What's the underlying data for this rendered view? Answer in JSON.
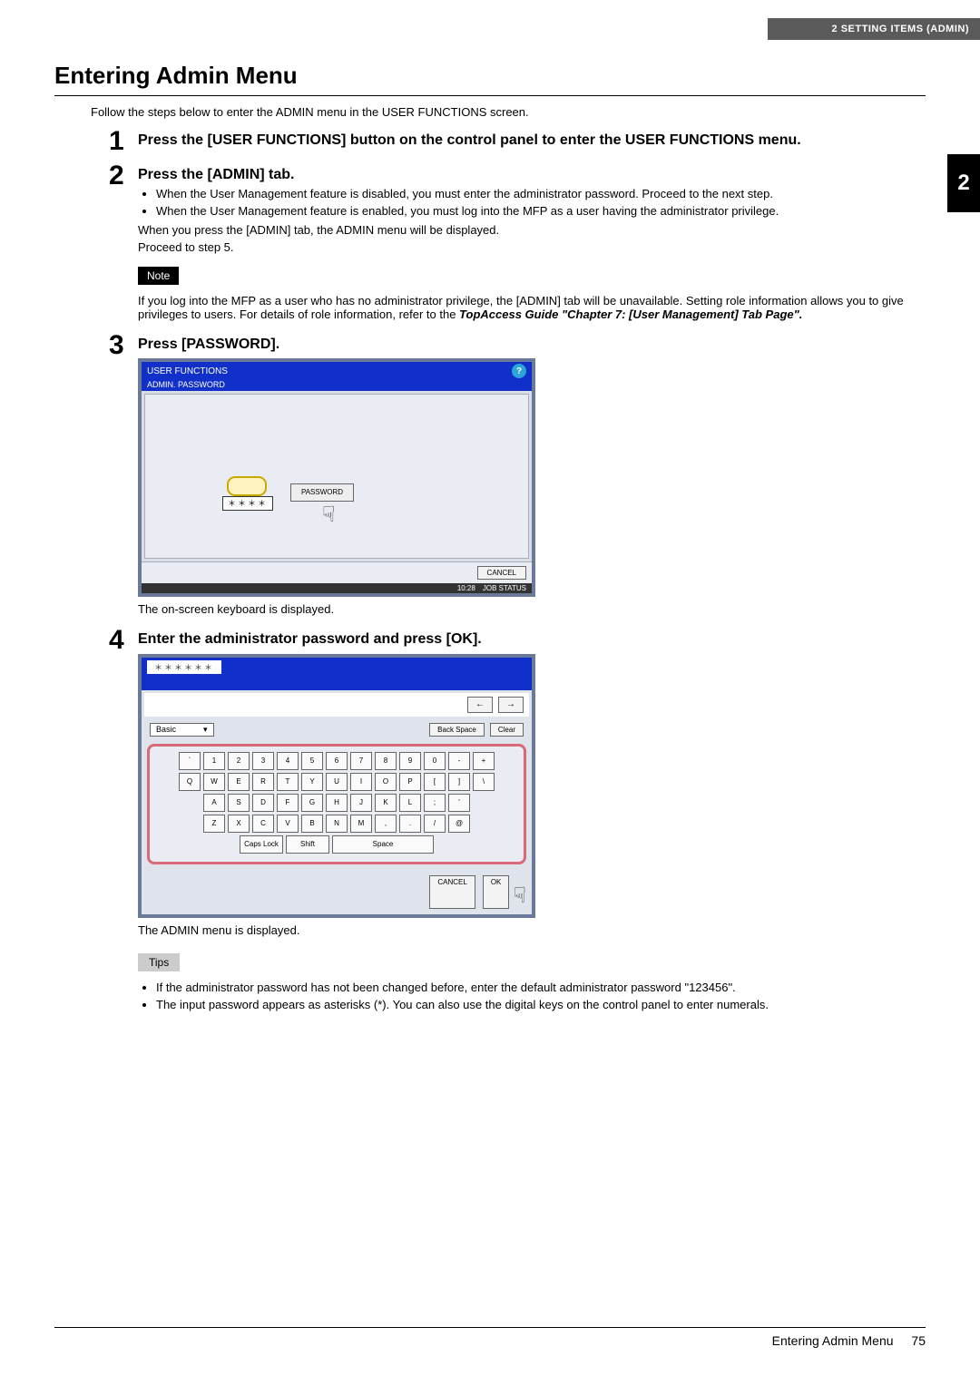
{
  "header": {
    "section_label": "2 SETTING ITEMS (ADMIN)",
    "chapter_tab": "2"
  },
  "title": "Entering Admin Menu",
  "intro": "Follow the steps below to enter the ADMIN menu in the USER FUNCTIONS screen.",
  "steps": [
    {
      "num": "1",
      "title": "Press the [USER FUNCTIONS] button on the control panel to enter the USER FUNCTIONS menu."
    },
    {
      "num": "2",
      "title": "Press the [ADMIN] tab.",
      "bullets": [
        "When the User Management feature is disabled, you must enter the administrator password. Proceed to the next step.",
        "When the User Management feature is enabled, you must log into the MFP as a user having the administrator privilege."
      ],
      "plain_after": [
        "When you press the [ADMIN] tab, the ADMIN menu will be displayed.",
        "Proceed to step 5."
      ],
      "note_label": "Note",
      "note_text": "If you log into the MFP as a user who has no administrator privilege, the [ADMIN] tab will be unavailable. Setting role information allows you to give privileges to users. For details of role information, refer to the ",
      "note_ref": "TopAccess Guide \"Chapter 7: [User Management] Tab Page\"."
    },
    {
      "num": "3",
      "title": "Press [PASSWORD].",
      "after_text": "The on-screen keyboard is displayed."
    },
    {
      "num": "4",
      "title": "Enter the administrator password and press [OK].",
      "after_text": "The ADMIN menu is displayed.",
      "tips_label": "Tips",
      "tips": [
        "If the administrator password has not been changed before, enter the default administrator password \"123456\".",
        "The input password appears as asterisks (*). You can also use the digital keys on the control panel to enter numerals."
      ]
    }
  ],
  "screenshot1": {
    "title_bar": "USER FUNCTIONS",
    "breadcrumb": "ADMIN. PASSWORD",
    "help": "?",
    "stars": "＊＊＊＊",
    "password_btn": "PASSWORD",
    "cancel": "CANCEL",
    "jobstatus": "JOB STATUS",
    "time": "10:28"
  },
  "screenshot2": {
    "input_stars": "＊＊＊＊＊＊",
    "arrow_left": "←",
    "arrow_right": "→",
    "dropdown_label": "Basic",
    "dropdown_caret": "▾",
    "backspace": "Back Space",
    "clear": "Clear",
    "row1": [
      "`",
      "1",
      "2",
      "3",
      "4",
      "5",
      "6",
      "7",
      "8",
      "9",
      "0",
      "-",
      "+"
    ],
    "row2": [
      "Q",
      "W",
      "E",
      "R",
      "T",
      "Y",
      "U",
      "I",
      "O",
      "P",
      "[",
      "]",
      "\\"
    ],
    "row3": [
      "A",
      "S",
      "D",
      "F",
      "G",
      "H",
      "J",
      "K",
      "L",
      ";",
      "'"
    ],
    "row4": [
      "Z",
      "X",
      "C",
      "V",
      "B",
      "N",
      "M",
      ",",
      ".",
      "/",
      "@"
    ],
    "caps": "Caps Lock",
    "shift": "Shift",
    "space": "Space",
    "cancel": "CANCEL",
    "ok": "OK"
  },
  "footer": {
    "label": "Entering Admin Menu",
    "page": "75"
  }
}
